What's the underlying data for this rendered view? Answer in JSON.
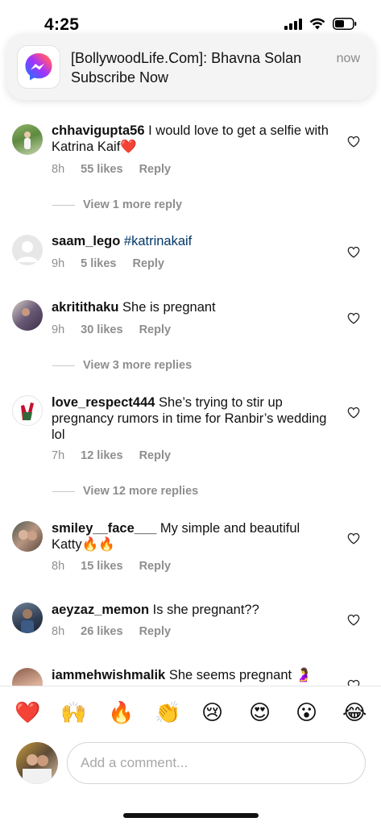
{
  "status_bar": {
    "time": "4:25"
  },
  "notification": {
    "title": "[BollywoodLife.Com]: Bhavna Solan",
    "body": "Subscribe Now",
    "time": "now"
  },
  "comments": [
    {
      "username": "chhavigupta56",
      "text": "I would love to get a selfie with Katrina Kaif❤️",
      "time": "8h",
      "likes": "55 likes",
      "reply": "Reply"
    },
    {
      "username": "saam_lego",
      "text": "#katrinakaif",
      "time": "9h",
      "likes": "5 likes",
      "reply": "Reply"
    },
    {
      "username": "akritithaku",
      "text": "She is pregnant",
      "time": "9h",
      "likes": "30 likes",
      "reply": "Reply"
    },
    {
      "username": "love_respect444",
      "text": "She’s trying to stir up pregnancy rumors in time for Ranbir’s wedding lol",
      "time": "7h",
      "likes": "12 likes",
      "reply": "Reply"
    },
    {
      "username": "smiley__face___",
      "text": "My simple and beautiful Katty🔥🔥",
      "time": "8h",
      "likes": "15 likes",
      "reply": "Reply"
    },
    {
      "username": "aeyzaz_memon",
      "text": "Is she pregnant??",
      "time": "8h",
      "likes": "26 likes",
      "reply": "Reply"
    },
    {
      "username": "iammehwishmalik",
      "text": "She seems pregnant 🤰"
    }
  ],
  "view_replies": [
    "View 1 more reply",
    "View 3 more replies",
    "View 12 more replies"
  ],
  "reactions": [
    "❤️",
    "🙌",
    "🔥",
    "👏",
    "😢",
    "😍",
    "😮",
    "😂"
  ],
  "composer": {
    "placeholder": "Add a comment..."
  }
}
